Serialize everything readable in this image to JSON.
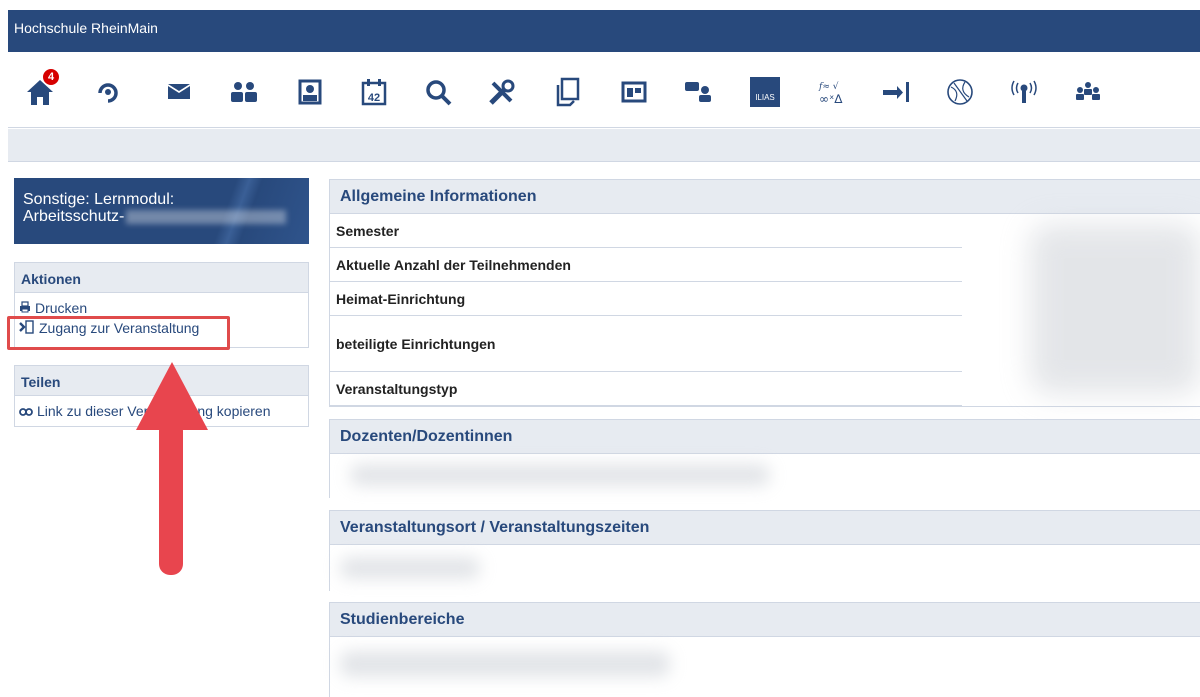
{
  "header": {
    "brand": "Hochschule RheinMain"
  },
  "nav": {
    "badge_count": "4",
    "ilias_label": "ILIAS",
    "icons": [
      "home-icon",
      "help-icon",
      "mail-icon",
      "community-icon",
      "profile-icon",
      "calendar-icon",
      "search-icon",
      "tools-icon",
      "files-icon",
      "courses-icon",
      "chat-icon",
      "ilias-icon",
      "formula-icon",
      "logout-icon",
      "globe-icon",
      "broadcast-icon",
      "groups-icon"
    ],
    "calendar_number": "42"
  },
  "sidebar": {
    "course_title_line1": "Sonstige: Lernmodul:",
    "course_title_line2": "Arbeitsschutz-",
    "actions": {
      "heading": "Aktionen",
      "items": [
        {
          "label": "Drucken",
          "icon": "print-icon"
        },
        {
          "label": "Zugang zur Veranstaltung",
          "icon": "enter-icon"
        }
      ]
    },
    "share": {
      "heading": "Teilen",
      "items": [
        {
          "label": "Link zu dieser Veranstaltung kopieren",
          "icon": "link-icon"
        }
      ]
    }
  },
  "main": {
    "general": {
      "heading": "Allgemeine Informationen",
      "rows": [
        "Semester",
        "Aktuelle Anzahl der Teilnehmenden",
        "Heimat-Einrichtung",
        "beteiligte Einrichtungen",
        "Veranstaltungstyp"
      ]
    },
    "lecturers": {
      "heading": "Dozenten/Dozentinnen"
    },
    "location": {
      "heading": "Veranstaltungsort / Veranstaltungszeiten"
    },
    "areas": {
      "heading": "Studienbereiche"
    }
  },
  "colors": {
    "primary": "#28497c",
    "header_bg": "#e7ebf1",
    "highlight": "#e04b4b",
    "badge": "#d60000"
  }
}
